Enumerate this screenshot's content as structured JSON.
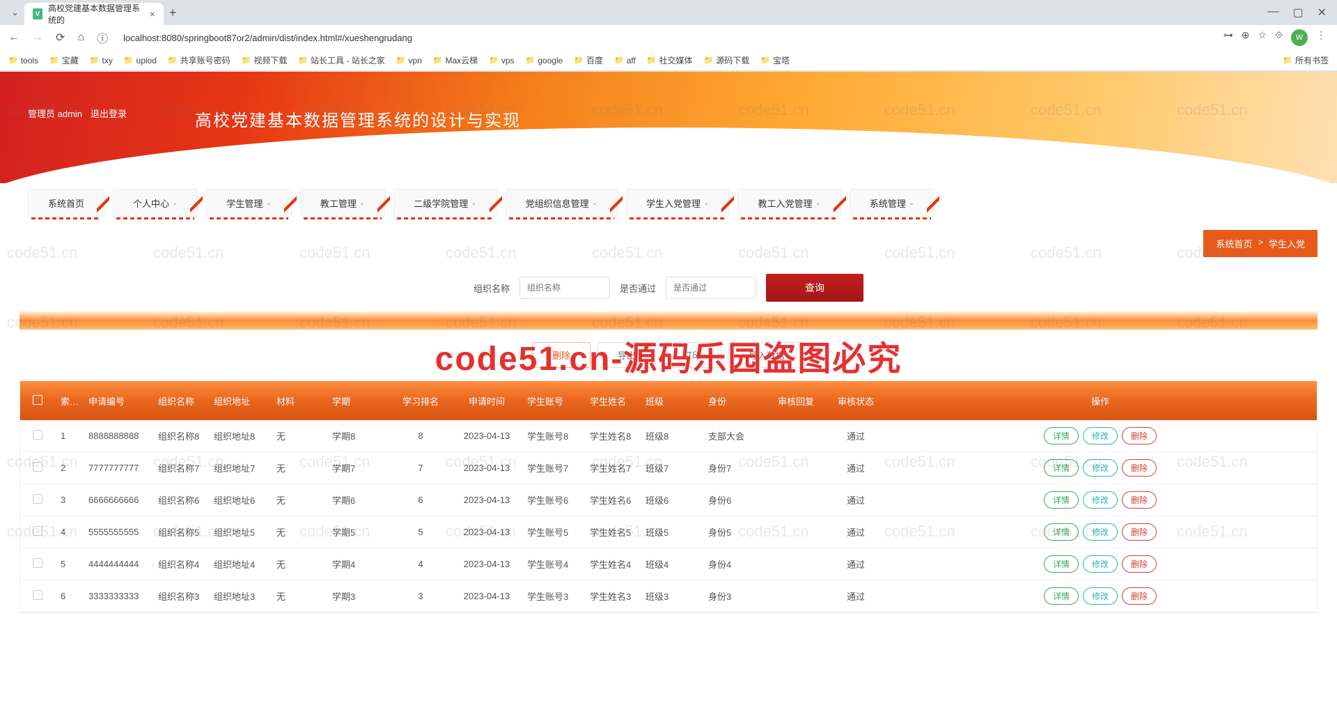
{
  "browser": {
    "tab_title": "高校党建基本数据管理系统的",
    "url": "localhost:8080/springboot87or2/admin/dist/index.html#/xueshengrudang",
    "bookmarks": [
      "tools",
      "宝藏",
      "txy",
      "uplod",
      "共享账号密码",
      "视频下载",
      "站长工具 - 站长之家",
      "vpn",
      "Max云梯",
      "vps",
      "google",
      "百度",
      "aff",
      "社交媒体",
      "源码下载",
      "宝塔"
    ],
    "all_bookmarks": "所有书签"
  },
  "header": {
    "admin_label": "管理员 admin",
    "logout": "退出登录",
    "title": "高校党建基本数据管理系统的设计与实现"
  },
  "nav": [
    {
      "label": "系统首页",
      "has_chevron": false
    },
    {
      "label": "个人中心",
      "has_chevron": true
    },
    {
      "label": "学生管理",
      "has_chevron": true
    },
    {
      "label": "教工管理",
      "has_chevron": true
    },
    {
      "label": "二级学院管理",
      "has_chevron": true
    },
    {
      "label": "党组织信息管理",
      "has_chevron": true
    },
    {
      "label": "学生入党管理",
      "has_chevron": true
    },
    {
      "label": "教工入党管理",
      "has_chevron": true
    },
    {
      "label": "系统管理",
      "has_chevron": true
    }
  ],
  "breadcrumb": {
    "home": "系统首页",
    "sep": ">",
    "current": "学生入党"
  },
  "search": {
    "org_label": "组织名称",
    "org_placeholder": "组织名称",
    "pass_label": "是否通过",
    "pass_placeholder": "是否通过",
    "button": "查询"
  },
  "toolbar": {
    "delete": "删除",
    "export": "导出",
    "print": "打印",
    "import": "导入数据"
  },
  "watermark_main": "code51.cn-源码乐园盗图必究",
  "watermark_small": "code51.cn",
  "columns": {
    "idx": "索引",
    "sno": "申请编号",
    "org": "组织名称",
    "addr": "组织地址",
    "mat": "材料",
    "term": "学期",
    "rank": "学习排名",
    "date": "申请时间",
    "acc": "学生账号",
    "name": "学生姓名",
    "cls": "班级",
    "id": "身份",
    "reply": "审核回复",
    "stat": "审核状态",
    "ops": "操作"
  },
  "ops": {
    "detail": "详情",
    "edit": "修改",
    "delete": "删除"
  },
  "rows": [
    {
      "idx": "1",
      "sno": "8888888888",
      "org": "组织名称8",
      "addr": "组织地址8",
      "mat": "无",
      "term": "学期8",
      "rank": "8",
      "date": "2023-04-13",
      "acc": "学生账号8",
      "name": "学生姓名8",
      "cls": "班级8",
      "id": "支部大会",
      "reply": "",
      "stat": "通过"
    },
    {
      "idx": "2",
      "sno": "7777777777",
      "org": "组织名称7",
      "addr": "组织地址7",
      "mat": "无",
      "term": "学期7",
      "rank": "7",
      "date": "2023-04-13",
      "acc": "学生账号7",
      "name": "学生姓名7",
      "cls": "班级7",
      "id": "身份7",
      "reply": "",
      "stat": "通过"
    },
    {
      "idx": "3",
      "sno": "6666666666",
      "org": "组织名称6",
      "addr": "组织地址6",
      "mat": "无",
      "term": "学期6",
      "rank": "6",
      "date": "2023-04-13",
      "acc": "学生账号6",
      "name": "学生姓名6",
      "cls": "班级6",
      "id": "身份6",
      "reply": "",
      "stat": "通过"
    },
    {
      "idx": "4",
      "sno": "5555555555",
      "org": "组织名称5",
      "addr": "组织地址5",
      "mat": "无",
      "term": "学期5",
      "rank": "5",
      "date": "2023-04-13",
      "acc": "学生账号5",
      "name": "学生姓名5",
      "cls": "班级5",
      "id": "身份5",
      "reply": "",
      "stat": "通过"
    },
    {
      "idx": "5",
      "sno": "4444444444",
      "org": "组织名称4",
      "addr": "组织地址4",
      "mat": "无",
      "term": "学期4",
      "rank": "4",
      "date": "2023-04-13",
      "acc": "学生账号4",
      "name": "学生姓名4",
      "cls": "班级4",
      "id": "身份4",
      "reply": "",
      "stat": "通过"
    },
    {
      "idx": "6",
      "sno": "3333333333",
      "org": "组织名称3",
      "addr": "组织地址3",
      "mat": "无",
      "term": "学期3",
      "rank": "3",
      "date": "2023-04-13",
      "acc": "学生账号3",
      "name": "学生姓名3",
      "cls": "班级3",
      "id": "身份3",
      "reply": "",
      "stat": "通过"
    }
  ]
}
